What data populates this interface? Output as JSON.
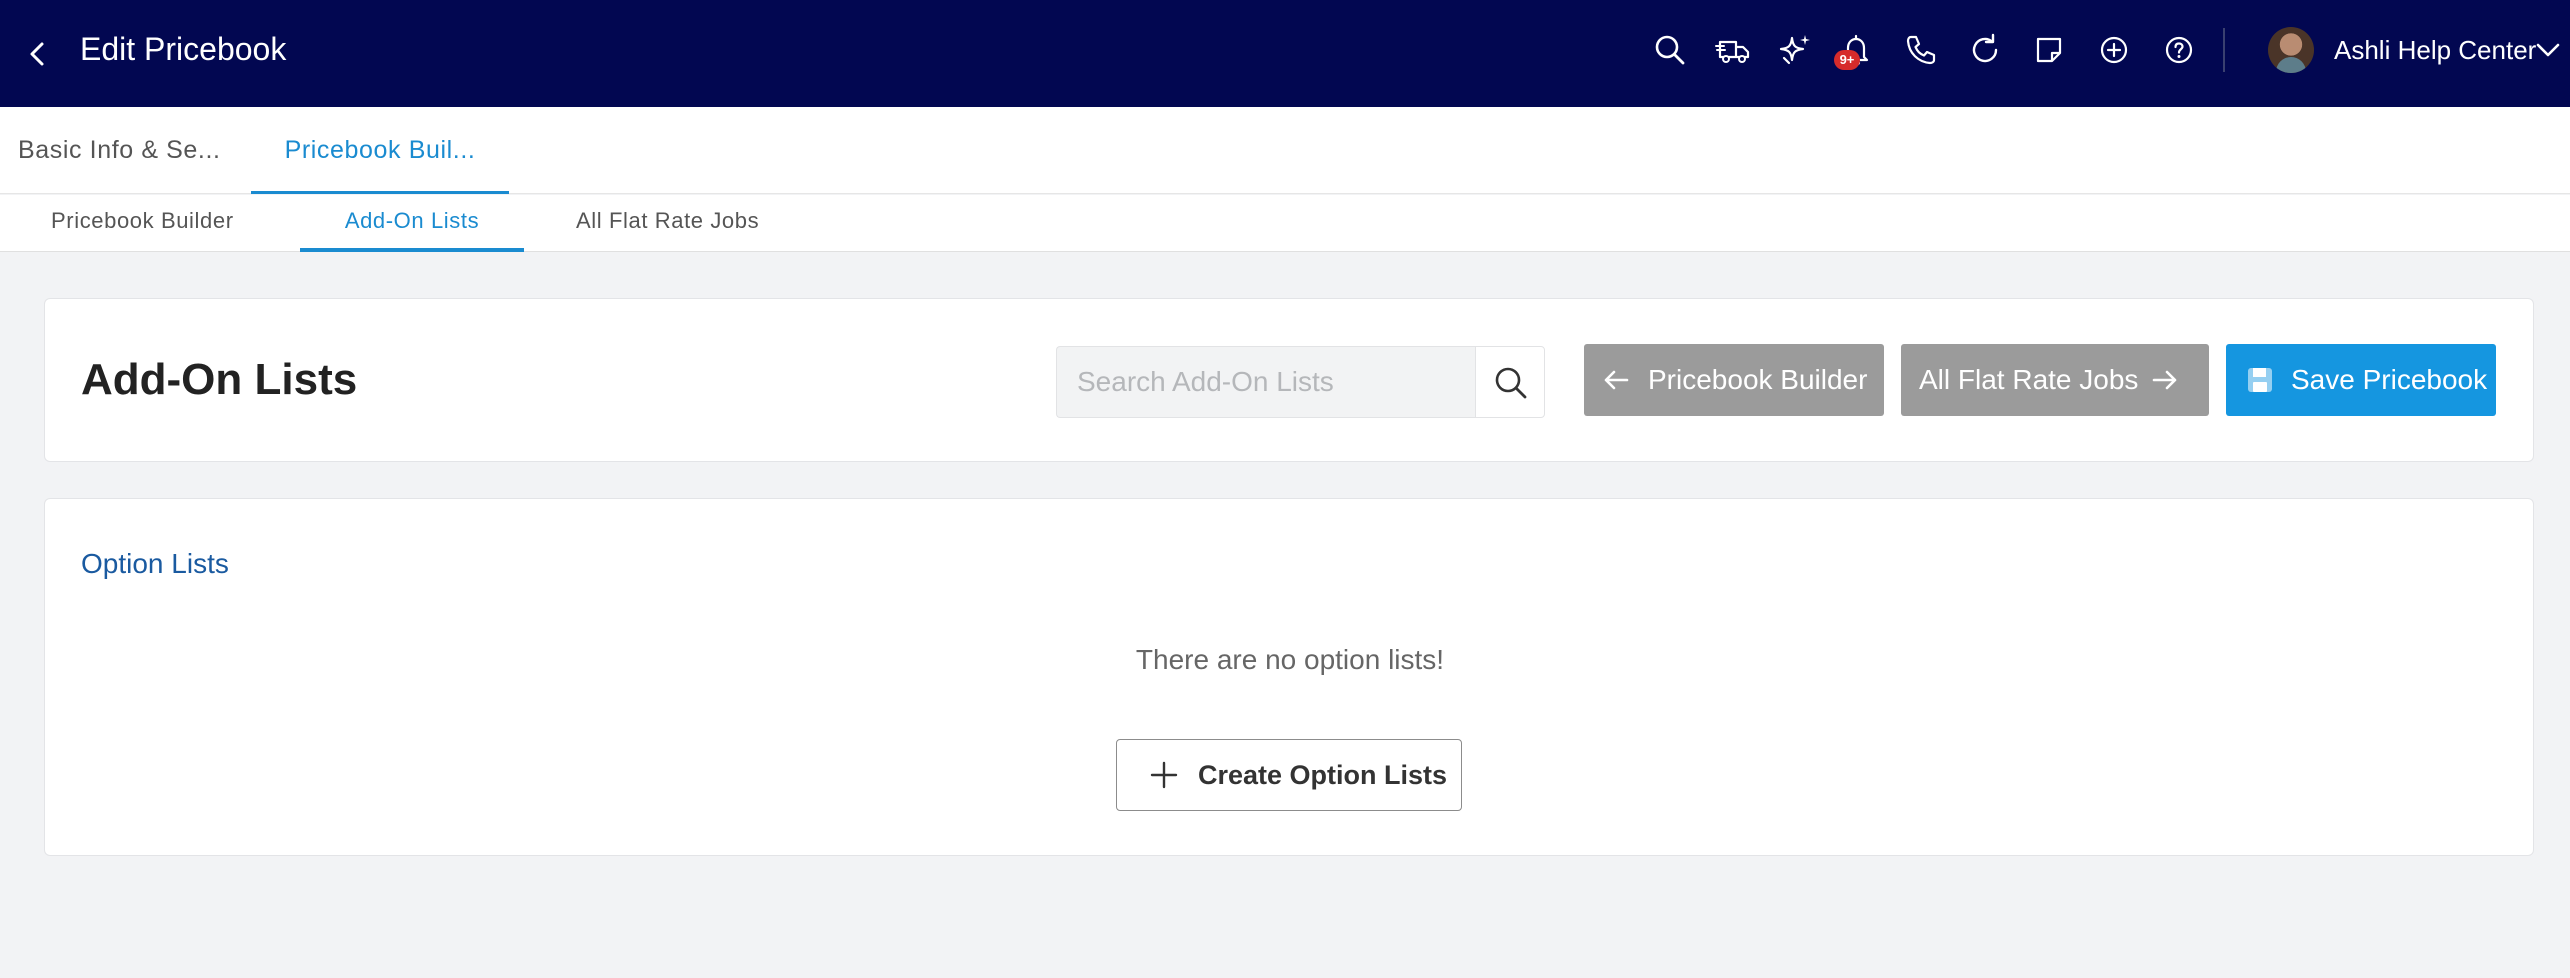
{
  "header": {
    "title": "Edit Pricebook",
    "notification_count": "9+",
    "user_name": "Ashli Help Center",
    "icons": [
      "back-icon",
      "search-icon",
      "dispatch-truck-icon",
      "sparkle-icon",
      "bell-icon",
      "phone-icon",
      "refresh-icon",
      "note-icon",
      "add-circle-icon",
      "help-icon",
      "chevron-down-icon"
    ]
  },
  "primary_tabs": [
    {
      "label": "Basic Info & Se...",
      "active": false
    },
    {
      "label": "Pricebook Buil...",
      "active": true
    }
  ],
  "secondary_tabs": [
    {
      "label": "Pricebook Builder",
      "active": false
    },
    {
      "label": "Add-On Lists",
      "active": true
    },
    {
      "label": "All Flat Rate Jobs",
      "active": false
    }
  ],
  "page": {
    "title": "Add-On Lists",
    "search_placeholder": "Search Add-On Lists",
    "search_value": "",
    "prev_button": "Pricebook Builder",
    "next_button": "All Flat Rate Jobs",
    "save_button": "Save Pricebook"
  },
  "option_lists": {
    "title": "Option Lists",
    "empty_message": "There are no option lists!",
    "create_button": "Create Option Lists"
  },
  "colors": {
    "header_bg": "#020751",
    "accent": "#1a8bd0",
    "save_button": "#1596e0",
    "nav_button": "#9b9b9b",
    "badge": "#d62b2b"
  }
}
